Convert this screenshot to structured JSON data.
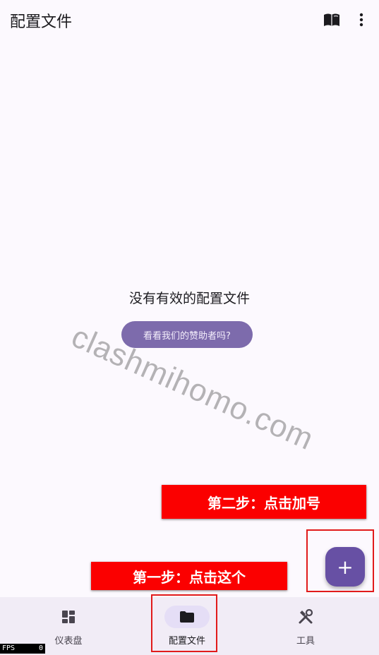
{
  "appbar": {
    "title": "配置文件",
    "book_icon": "book-open-icon",
    "more_icon": "more-vert-icon"
  },
  "empty_state": {
    "message": "没有有效的配置文件",
    "sponsor_button": "看看我们的赞助者吗?"
  },
  "watermark": "clashmihomo.com",
  "annotations": {
    "step2": "第二步：点击加号",
    "step1": "第一步：点击这个",
    "color": "#fb0000"
  },
  "fab": {
    "label": "+",
    "icon": "add-icon",
    "color": "#6750a4"
  },
  "nav": {
    "items": [
      {
        "label": "仪表盘",
        "icon": "dashboard-icon",
        "active": false
      },
      {
        "label": "配置文件",
        "icon": "folder-icon",
        "active": true
      },
      {
        "label": "工具",
        "icon": "tools-icon",
        "active": false
      }
    ]
  },
  "fps": {
    "label": "FPS",
    "value": "0"
  },
  "colors": {
    "background": "#fcf9fe",
    "navbar": "#f1ecf6",
    "primary": "#6750a4",
    "sponsor": "#7d6bac"
  }
}
